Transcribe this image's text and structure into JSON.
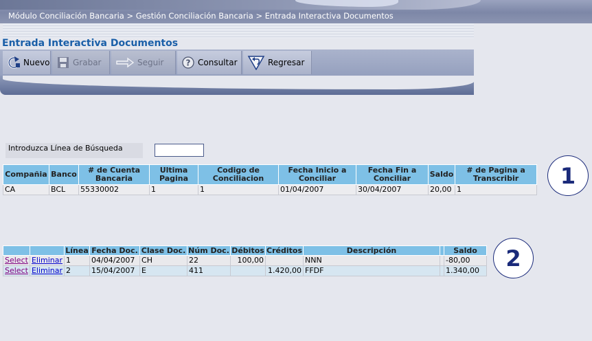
{
  "breadcrumb": "Módulo Conciliación Bancaria > Gestión Conciliación Bancaria > Entrada Interactiva Documentos",
  "page_title": "Entrada Interactiva Documentos",
  "toolbar": {
    "nuevo": "Nuevo",
    "grabar": "Grabar",
    "seguir": "Seguir",
    "consultar": "Consultar",
    "regresar": "Regresar"
  },
  "search": {
    "label": "Introduzca Línea de Búsqueda",
    "value": ""
  },
  "table1": {
    "headers": [
      "Compañia",
      "Banco",
      "# de Cuenta Bancaria",
      "Ultima Pagina",
      "Codigo de Conciliacion",
      "Fecha Inicio a Conciliar",
      "Fecha Fin a Conciliar",
      "Saldo",
      "# de Pagina a Transcribir"
    ],
    "rows": [
      [
        "CA",
        "BCL",
        "55330002",
        "1",
        "1",
        "01/04/2007",
        "30/04/2007",
        "20,00",
        "1"
      ]
    ]
  },
  "table2": {
    "headers": [
      "",
      "",
      "Línea",
      "Fecha Doc.",
      "Clase Doc.",
      "Núm Doc.",
      "Débitos",
      "Créditos",
      "Descripción",
      "",
      "Saldo"
    ],
    "rows": [
      {
        "select": "Select",
        "eliminar": "Eliminar",
        "linea": "1",
        "fecha": "04/04/2007",
        "clase": "CH",
        "num": "22",
        "debitos": "100,00",
        "creditos": "",
        "descripcion": "NNN",
        "blank": "",
        "saldo": "-80,00"
      },
      {
        "select": "Select",
        "eliminar": "Eliminar",
        "linea": "2",
        "fecha": "15/04/2007",
        "clase": "E",
        "num": "411",
        "debitos": "",
        "creditos": "1.420,00",
        "descripcion": "FFDF",
        "blank": "",
        "saldo": "1.340,00"
      }
    ]
  },
  "annotations": [
    "1",
    "2"
  ],
  "colors": {
    "title": "#1a5fa8",
    "header_blue": "#7ec0e6",
    "row_alt": "#d6e6f1",
    "annotation": "#1a2a7a"
  }
}
